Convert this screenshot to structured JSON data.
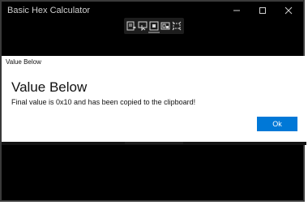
{
  "window": {
    "title": "Basic Hex Calculator"
  },
  "toolbar": {
    "buttons": [
      {
        "name": "export-icon"
      },
      {
        "name": "pointer-icon"
      },
      {
        "name": "record-icon"
      },
      {
        "name": "capture-icon"
      },
      {
        "name": "crop-icon"
      }
    ]
  },
  "dialog": {
    "header": "Value Below",
    "title": "Value Below",
    "message": "Final value is 0x10 and has been copied to the clipboard!",
    "ok_label": "Ok"
  },
  "colors": {
    "accent": "#0078d7",
    "window_bg": "#000000",
    "dialog_bg": "#ffffff"
  }
}
